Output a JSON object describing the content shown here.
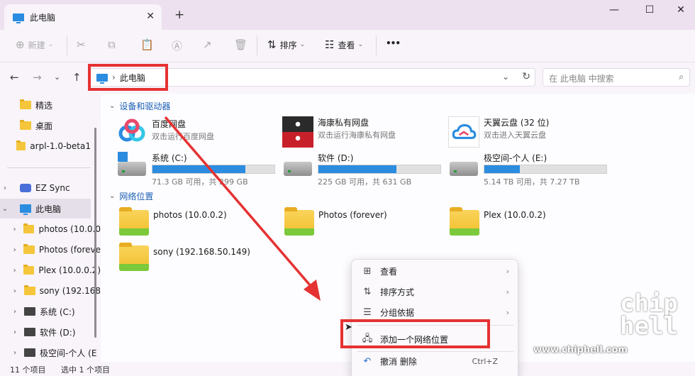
{
  "tab": {
    "title": "此电脑"
  },
  "window": {
    "minimize": "—",
    "maximize": "☐",
    "close": "✕"
  },
  "toolbar": {
    "new_label": "新建",
    "sort_label": "排序",
    "view_label": "查看",
    "more_label": "•••"
  },
  "address": {
    "crumb": "此电脑",
    "search_placeholder": "在 此电脑 中搜索"
  },
  "sidebar": {
    "items": [
      {
        "label": "精选"
      },
      {
        "label": "桌面"
      },
      {
        "label": "arpl-1.0-beta1"
      },
      {
        "label": "EZ Sync"
      },
      {
        "label": "此电脑"
      },
      {
        "label": "photos (10.0.0"
      },
      {
        "label": "Photos (foreve"
      },
      {
        "label": "Plex (10.0.0.2)"
      },
      {
        "label": "sony (192.168"
      },
      {
        "label": "系统 (C:)"
      },
      {
        "label": "软件 (D:)"
      },
      {
        "label": "极空间-个人 (E"
      }
    ]
  },
  "main": {
    "group_devices": "设备和驱动器",
    "group_network": "网络位置",
    "apps": [
      {
        "name": "百度网盘",
        "sub": "双击运行百度网盘"
      },
      {
        "name": "海康私有网盘",
        "sub": "双击运行海康私有网盘"
      },
      {
        "name": "天翼云盘 (32 位)",
        "sub": "双击进入天翼云盘"
      }
    ],
    "drives": [
      {
        "name": "系统 (C:)",
        "cap": "71.3 GB 可用，共 299 GB",
        "used_fraction": 0.76
      },
      {
        "name": "软件 (D:)",
        "cap": "225 GB 可用，共 631 GB",
        "used_fraction": 0.64
      },
      {
        "name": "极空间-个人 (E:)",
        "cap": "5.14 TB 可用，共 7.27 TB",
        "used_fraction": 0.29
      }
    ],
    "network": [
      {
        "name": "photos (10.0.0.2)"
      },
      {
        "name": "Photos (forever)"
      },
      {
        "name": "Plex (10.0.0.2)"
      },
      {
        "name": "sony (192.168.50.149)"
      }
    ]
  },
  "status": {
    "count": "11 个项目",
    "selected": "选中 1 个项目"
  },
  "context_menu": {
    "view": "查看",
    "sort": "排序方式",
    "group": "分组依据",
    "add_network": "添加一个网络位置",
    "undo": "撤消 删除",
    "undo_shortcut": "Ctrl+Z"
  },
  "watermark": {
    "site": "www.chiphell.com",
    "logo": "chip hell"
  },
  "colors": {
    "accent": "#2b8ce0",
    "highlight": "#e53232",
    "folder": "#f5c63b"
  }
}
